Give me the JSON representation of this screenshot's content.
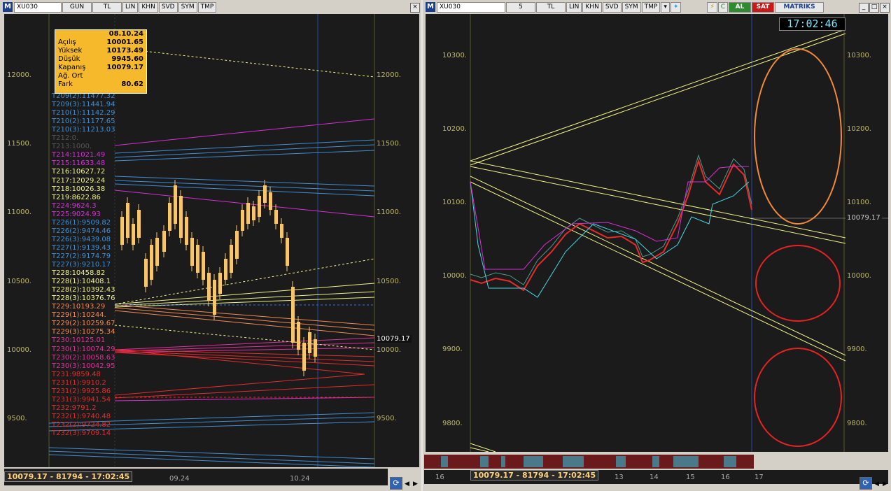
{
  "left": {
    "symbol": "XU030",
    "toolbar": [
      "GUN",
      "TL",
      "LIN",
      "KHN",
      "SVD",
      "SYM",
      "TMP"
    ],
    "ohlc": {
      "date": "08.10.24",
      "rows": [
        {
          "k": "Açılış",
          "v": "10001.65"
        },
        {
          "k": "Yüksek",
          "v": "10173.49"
        },
        {
          "k": "Düşük",
          "v": "9945.60"
        },
        {
          "k": "Kapanış",
          "v": "10079.17"
        },
        {
          "k": "Ağ. Ort",
          "v": ""
        },
        {
          "k": "Fark",
          "v": "80.62"
        }
      ]
    },
    "y_ticks": [
      "12000.",
      "11500.",
      "11000.",
      "10500.",
      "10000.",
      "9500."
    ],
    "last_price": "10079.17",
    "status": "10079.17 - 81794 - 17:02:45",
    "x_ticks": [
      "09.24",
      "10.24"
    ],
    "labels": [
      {
        "t": "T209(2):11477.32",
        "c": "#3f8fd4"
      },
      {
        "t": "T209(3):11441.94",
        "c": "#3f8fd4"
      },
      {
        "t": "T210(1):11142.29",
        "c": "#3f8fd4"
      },
      {
        "t": "T210(2):11177.65",
        "c": "#3f8fd4"
      },
      {
        "t": "T210(3):11213.03",
        "c": "#3f8fd4"
      },
      {
        "t": "T212:0.",
        "c": "#555555"
      },
      {
        "t": "T213:1000.",
        "c": "#555555"
      },
      {
        "t": "T214:11021.49",
        "c": "#d72fd7"
      },
      {
        "t": "T215:11633.48",
        "c": "#d72fd7"
      },
      {
        "t": "T216:10627.72",
        "c": "#f2f28a"
      },
      {
        "t": "T217:12029.24",
        "c": "#f2f28a"
      },
      {
        "t": "T218:10026.38",
        "c": "#f2f28a"
      },
      {
        "t": "T219:8622.86",
        "c": "#f2f28a"
      },
      {
        "t": "T224:9624.3",
        "c": "#d72fd7"
      },
      {
        "t": "T225:9024.93",
        "c": "#d72fd7"
      },
      {
        "t": "T226(1):9509.82",
        "c": "#3f8fd4"
      },
      {
        "t": "T226(2):9474.46",
        "c": "#3f8fd4"
      },
      {
        "t": "T226(3):9439.08",
        "c": "#3f8fd4"
      },
      {
        "t": "T227(1):9139.43",
        "c": "#3f8fd4"
      },
      {
        "t": "T227(2):9174.79",
        "c": "#3f8fd4"
      },
      {
        "t": "T227(3):9210.17",
        "c": "#3f8fd4"
      },
      {
        "t": "T228:10458.82",
        "c": "#f2f28a"
      },
      {
        "t": "T228(1):10408.1",
        "c": "#f2f28a"
      },
      {
        "t": "T228(2):10392.43",
        "c": "#f2f28a"
      },
      {
        "t": "T228(3):10376.76",
        "c": "#f2f28a"
      },
      {
        "t": "T229:10193.29",
        "c": "#f28a55"
      },
      {
        "t": "T229(1):10244.",
        "c": "#f28a55"
      },
      {
        "t": "T229(2):10259.67",
        "c": "#f28a55"
      },
      {
        "t": "T229(3):10275.34",
        "c": "#f28a55"
      },
      {
        "t": "T230:10125.01",
        "c": "#e0309a"
      },
      {
        "t": "T230(1):10074.29",
        "c": "#e0309a"
      },
      {
        "t": "T230(2):10058.63",
        "c": "#e0309a"
      },
      {
        "t": "T230(3):10042.95",
        "c": "#e0309a"
      },
      {
        "t": "T231:9859.48",
        "c": "#e82a2a"
      },
      {
        "t": "T231(1):9910.2",
        "c": "#e82a2a"
      },
      {
        "t": "T231(2):9925.86",
        "c": "#e82a2a"
      },
      {
        "t": "T231(3):9941.54",
        "c": "#e82a2a"
      },
      {
        "t": "T232:9791.2",
        "c": "#e82a2a"
      },
      {
        "t": "T232(1):9740.48",
        "c": "#e82a2a"
      },
      {
        "t": "T232(2):9724.82",
        "c": "#e82a2a"
      },
      {
        "t": "T232(3):9709.14",
        "c": "#e82a2a"
      }
    ]
  },
  "right": {
    "symbol": "XU030",
    "toolbar": [
      "5",
      "TL",
      "LIN",
      "KHN",
      "SVD",
      "SYM",
      "TMP"
    ],
    "buy_label": "AL",
    "sell_label": "SAT",
    "brand": "MATRIKS",
    "clock": "17:02:46",
    "y_ticks": [
      "10300.",
      "10200.",
      "10100.",
      "10000.",
      "9900.",
      "9800."
    ],
    "last_price": "10079.17",
    "status": "10079.17 - 81794 - 17:02:45",
    "x_ticks": [
      "16",
      "13",
      "14",
      "15",
      "16",
      "17"
    ]
  },
  "colors": {
    "bg": "#1b1b1b",
    "axis": "#bdb76b",
    "candle_up": "#f6c66b",
    "trend": "#f2f28a",
    "magenta": "#d72fd7",
    "cyan": "#45d7e8",
    "orange_ellipse": "#f28a3a",
    "red_ellipse": "#e82222"
  }
}
